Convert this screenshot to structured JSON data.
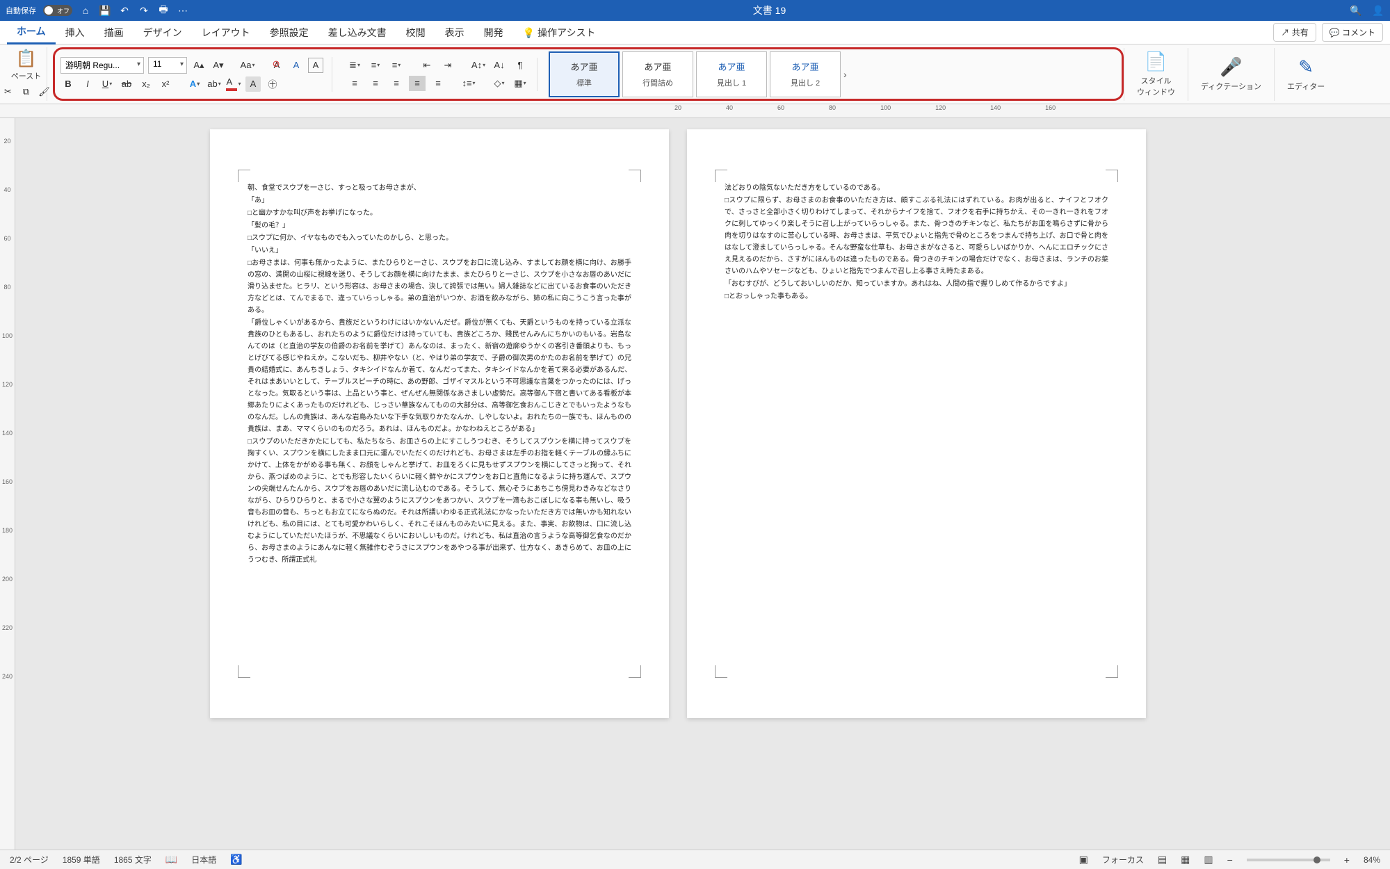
{
  "titlebar": {
    "autosave_label": "自動保存",
    "autosave_state": "オフ",
    "doc_title": "文書 19"
  },
  "tabs": {
    "items": [
      "ホーム",
      "挿入",
      "描画",
      "デザイン",
      "レイアウト",
      "参照設定",
      "差し込み文書",
      "校閲",
      "表示",
      "開発"
    ],
    "assist": "操作アシスト",
    "share": "共有",
    "comment": "コメント"
  },
  "ribbon": {
    "paste": "ペースト",
    "font_name": "游明朝 Regu...",
    "font_size": "11",
    "styles": [
      {
        "sample": "あア亜",
        "name": "標準"
      },
      {
        "sample": "あア亜",
        "name": "行間詰め"
      },
      {
        "sample": "あア亜",
        "name": "見出し 1"
      },
      {
        "sample": "あア亜",
        "name": "見出し 2"
      }
    ],
    "style_pane": "スタイル\nウィンドウ",
    "dictation": "ディクテーション",
    "editor": "エディター"
  },
  "ruler_h": [
    "20",
    "",
    "40",
    "",
    "60",
    "",
    "80",
    "",
    "100",
    "",
    "120",
    "",
    "140",
    "",
    "160"
  ],
  "ruler_v": [
    "20",
    "40",
    "60",
    "80",
    "100",
    "120",
    "140",
    "160",
    "180",
    "200",
    "220",
    "240"
  ],
  "page1": {
    "lines": [
      "朝、食堂でスウプを一さじ、すっと吸ってお母さまが、",
      "「あ」",
      "□と幽かすかな叫び声をお挙げになった。",
      "「髪の毛？」",
      "□スウプに何か、イヤなものでも入っていたのかしら、と思った。",
      "「いいえ」",
      "□お母さまは、何事も無かったように、またひらりと一さじ、スウプをお口に流し込み、すましてお顔を横に向け、お勝手の窓の、満開の山桜に視線を送り、そうしてお顔を横に向けたまま、またひらりと一さじ、スウプを小さなお唇のあいだに滑り込ませた。ヒラリ、という形容は、お母さまの場合、決して誇張では無い。婦人雑誌などに出ているお食事のいただき方などとは、てんでまるで、違っていらっしゃる。弟の直治がいつか、お酒を飲みながら、姉の私に向こうこう言った事がある。",
      "「爵位しゃくいがあるから、貴族だというわけにはいかないんだぜ。爵位が無くても、天爵というものを持っている立派な貴族のひともあるし、おれたちのように爵位だけは持っていても、貴族どころか、賤民せんみんにちかいのもいる。岩島なんてのは（と直治の学友の伯爵のお名前を挙げて）あんなのは、まったく、新宿の遊廓ゆうかくの客引き番頭よりも、もっとげびてる感じやねえか。こないだも、柳井やない（と、やはり弟の学友で、子爵の御次男のかたのお名前を挙げて）の兄貴の結婚式に、あんちきしょう、タキシイドなんか着て、なんだってまた、タキシイドなんかを着て来る必要があるんだ、それはまあいいとして、テーブルスピーチの時に、あの野郎、ゴザイマスルという不可思議な言葉をつかったのには、げっとなった。気取るという事は、上品という事と、ぜんぜん無関係なあさましい虚勢だ。高等御ん下宿と書いてある看板が本郷あたりによくあったものだけれども、じっさい華族なんてものの大部分は、高等御乞食おんこじきとでもいったようなものなんだ。しんの貴族は、あんな岩島みたいな下手な気取りかたなんか、しやしないよ。おれたちの一族でも、ほんものの貴族は、まあ、ママくらいのものだろう。あれは、ほんものだよ。かなわねえところがある」",
      "□スウプのいただきかたにしても、私たちなら、お皿さらの上にすこしうつむき、そうしてスプウンを横に持ってスウプを掬すくい、スプウンを横にしたまま口元に運んでいただくのだけれども、お母さまは左手のお指を軽くテーブルの縁ふちにかけて、上体をかがめる事も無く、お顔をしゃんと挙げて、お皿をろくに見もせずスプウンを横にしてさっと掬って、それから、燕つばめのように、とでも形容したいくらいに軽く鮮やかにスプウンをお口と直角になるように持ち運んで、スプウンの尖端せんたんから、スウプをお唇のあいだに流し込むのである。そうして、無心そうにあちこち傍見わきみなどなさりながら、ひらりひらりと、まるで小さな翼のようにスプウンをあつかい、スウプを一滴もおこぼしになる事も無いし、吸う音もお皿の音も、ちっともお立てにならぬのだ。それは所謂いわゆる正式礼法にかなったいただき方では無いかも知れないけれども、私の目には、とても可愛かわいらしく、それこそほんものみたいに見える。また、事実、お飲物は、口に流し込むようにしていただいたほうが、不思議なくらいにおいしいものだ。けれども、私は直治の言うような高等御乞食なのだから、お母さまのようにあんなに軽く無雑作むぞうさにスプウンをあやつる事が出来ず、仕方なく、あきらめて、お皿の上にうつむき、所謂正式礼"
    ]
  },
  "page2": {
    "lines": [
      "法どおりの陰気ないただき方をしているのである。",
      "□スウプに限らず、お母さまのお食事のいただき方は、頗すこぶる礼法にはずれている。お肉が出ると、ナイフとフオクで、さっさと全部小さく切りわけてしまって、それからナイフを捨て、フオクを右手に持ちかえ、その一きれ一きれをフオクに刺してゆっくり楽しそうに召し上がっていらっしゃる。また、骨つきのチキンなど、私たちがお皿を鳴らさずに骨から肉を切りはなすのに苦心している時、お母さまは、平気でひょいと指先で骨のところをつまんで持ち上げ、お口で骨と肉をはなして澄ましていらっしゃる。そんな野蛮な仕草も、お母さまがなさると、可愛らしいばかりか、へんにエロチックにさえ見えるのだから、さすがにほんものは違ったものである。骨つきのチキンの場合だけでなく、お母さまは、ランチのお菜さいのハムやソセージなども、ひょいと指先でつまんで召し上る事さえ時たまある。",
      "「おむすびが、どうしておいしいのだか、知っていますか。あれはね、人間の指で握りしめて作るからですよ」",
      "□とおっしゃった事もある。"
    ]
  },
  "status": {
    "page": "2/2 ページ",
    "words": "1859 単語",
    "chars": "1865 文字",
    "lang": "日本語",
    "focus": "フォーカス",
    "zoom": "84%"
  }
}
